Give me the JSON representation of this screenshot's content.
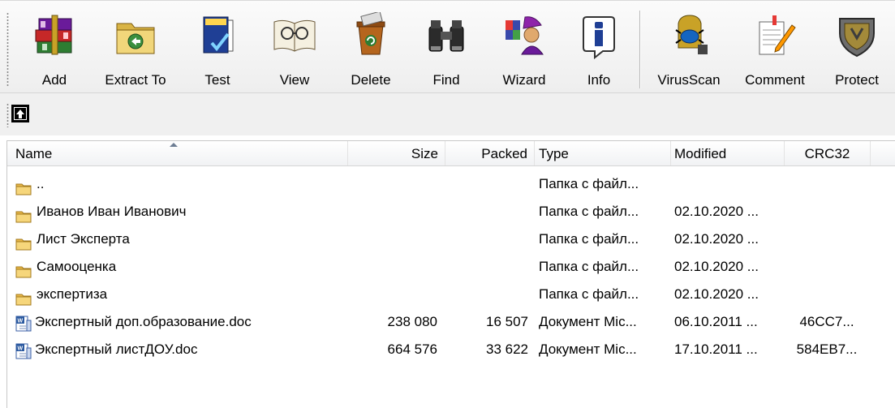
{
  "toolbar": {
    "buttons": [
      {
        "label": "Add",
        "icon": "winrar-books-icon"
      },
      {
        "label": "Extract To",
        "icon": "extract-folder-icon"
      },
      {
        "label": "Test",
        "icon": "test-document-icon"
      },
      {
        "label": "View",
        "icon": "view-glasses-book-icon"
      },
      {
        "label": "Delete",
        "icon": "recycle-bin-icon"
      },
      {
        "label": "Find",
        "icon": "binoculars-icon"
      },
      {
        "label": "Wizard",
        "icon": "wizard-icon"
      },
      {
        "label": "Info",
        "icon": "info-icon"
      },
      {
        "label": "VirusScan",
        "icon": "virus-scan-icon"
      },
      {
        "label": "Comment",
        "icon": "comment-pencil-icon"
      },
      {
        "label": "Protect",
        "icon": "protect-shield-icon"
      }
    ]
  },
  "pathbar": {
    "up_icon": "up-folder-icon"
  },
  "columns": {
    "name": "Name",
    "size": "Size",
    "packed": "Packed",
    "type": "Type",
    "modified": "Modified",
    "crc": "CRC32"
  },
  "files": [
    {
      "kind": "folder",
      "name": "..",
      "size": "",
      "packed": "",
      "type": "Папка с файл...",
      "modified": "",
      "crc": ""
    },
    {
      "kind": "folder",
      "name": "Иванов Иван Иванович",
      "size": "",
      "packed": "",
      "type": "Папка с файл...",
      "modified": "02.10.2020 ...",
      "crc": ""
    },
    {
      "kind": "folder",
      "name": "Лист Эксперта",
      "size": "",
      "packed": "",
      "type": "Папка с файл...",
      "modified": "02.10.2020 ...",
      "crc": ""
    },
    {
      "kind": "folder",
      "name": "Самооценка",
      "size": "",
      "packed": "",
      "type": "Папка с файл...",
      "modified": "02.10.2020 ...",
      "crc": ""
    },
    {
      "kind": "folder",
      "name": "экспертиза",
      "size": "",
      "packed": "",
      "type": "Папка с файл...",
      "modified": "02.10.2020 ...",
      "crc": ""
    },
    {
      "kind": "doc",
      "name": "Экспертный доп.образование.doc",
      "size": "238 080",
      "packed": "16 507",
      "type": "Документ Mic...",
      "modified": "06.10.2011 ...",
      "crc": "46CC7..."
    },
    {
      "kind": "doc",
      "name": "Экспертный листДОУ.doc",
      "size": "664 576",
      "packed": "33 622",
      "type": "Документ Mic...",
      "modified": "17.10.2011 ...",
      "crc": "584EB7..."
    }
  ],
  "colors": {
    "folder": "#e8b84a",
    "header_border": "#d5d5d5",
    "accent_blue": "#2c5aa0"
  }
}
